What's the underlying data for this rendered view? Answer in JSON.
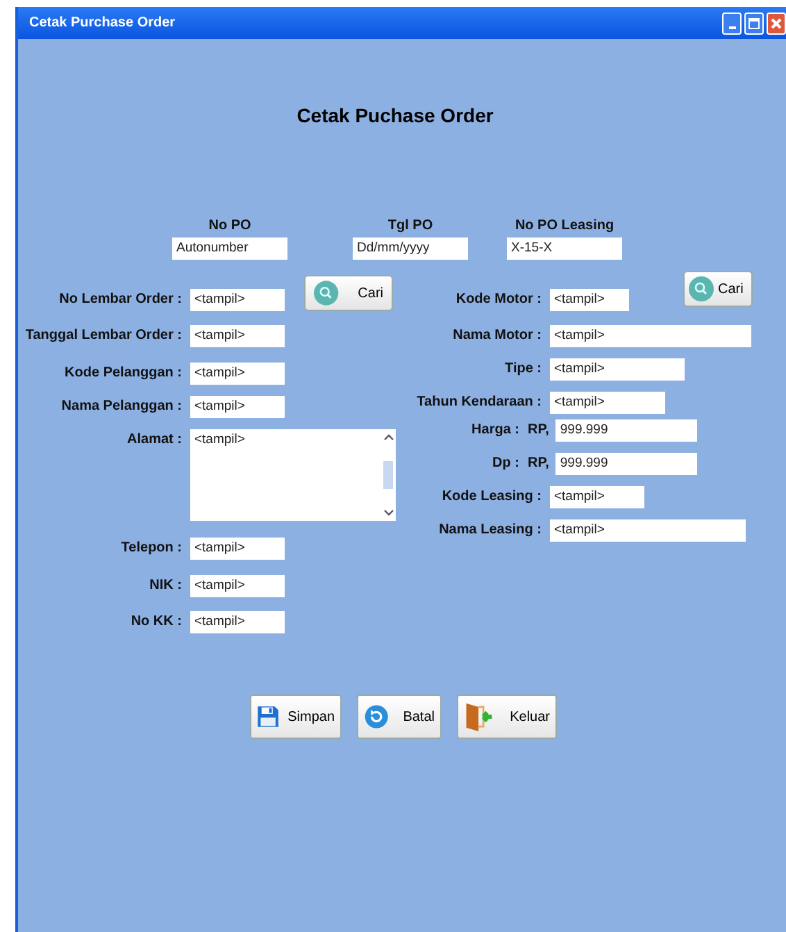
{
  "window": {
    "title": "Cetak Purchase Order"
  },
  "heading": "Cetak Puchase Order",
  "header_fields": [
    {
      "label": "No PO",
      "value": "Autonumber"
    },
    {
      "label": "Tgl PO",
      "value": "Dd/mm/yyyy"
    },
    {
      "label": "No PO Leasing",
      "value": "X-15-X"
    }
  ],
  "left_fields": [
    {
      "kind": "text",
      "label": "No Lembar Order :",
      "value": "<tampil>"
    },
    {
      "kind": "text",
      "label": "Tanggal Lembar Order :",
      "value": "<tampil>"
    },
    {
      "kind": "text",
      "label": "Kode Pelanggan :",
      "value": "<tampil>"
    },
    {
      "kind": "text",
      "label": "Nama Pelanggan :",
      "value": "<tampil>"
    },
    {
      "kind": "textarea",
      "label": "Alamat :",
      "value": "<tampil>"
    },
    {
      "kind": "text",
      "label": "Telepon :",
      "value": "<tampil>"
    },
    {
      "kind": "text",
      "label": "NIK :",
      "value": "<tampil>"
    },
    {
      "kind": "text",
      "label": "No KK :",
      "value": "<tampil>"
    }
  ],
  "left_search_button": "Cari",
  "right_fields": [
    {
      "kind": "text",
      "label": "Kode Motor :",
      "value": "<tampil>"
    },
    {
      "kind": "text",
      "label": "Nama Motor :",
      "value": "<tampil>"
    },
    {
      "kind": "text",
      "label": "Tipe :",
      "value": "<tampil>"
    },
    {
      "kind": "text",
      "label": "Tahun Kendaraan :",
      "value": "<tampil>"
    },
    {
      "kind": "currency",
      "label": "Harga :",
      "prefix": "RP,",
      "value": "999.999"
    },
    {
      "kind": "currency",
      "label": "Dp :",
      "prefix": "RP,",
      "value": "999.999"
    },
    {
      "kind": "text",
      "label": "Kode Leasing :",
      "value": "<tampil>"
    },
    {
      "kind": "text",
      "label": "Nama Leasing :",
      "value": "<tampil>"
    }
  ],
  "right_search_button": "Cari",
  "buttons": [
    {
      "kind": "save",
      "label": "Simpan"
    },
    {
      "kind": "cancel",
      "label": "Batal"
    },
    {
      "kind": "exit",
      "label": "Keluar"
    }
  ]
}
